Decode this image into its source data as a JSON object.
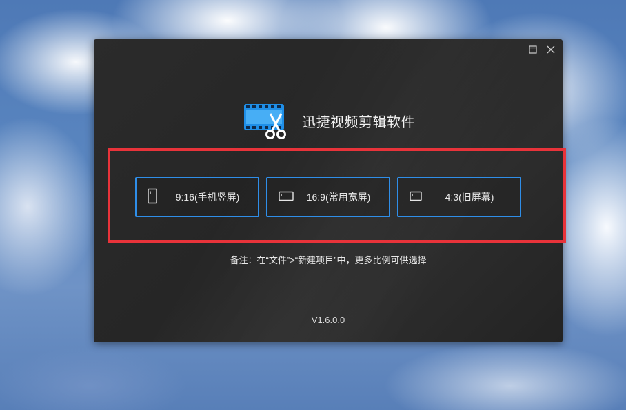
{
  "window": {
    "app_title": "迅捷视频剪辑软件",
    "controls": {
      "restore_icon": "restore-icon",
      "close_icon": "close-icon"
    }
  },
  "ratio_options": [
    {
      "label": "9:16(手机竖屏)",
      "icon": "portrait-screen-icon"
    },
    {
      "label": "16:9(常用宽屏)",
      "icon": "widescreen-icon"
    },
    {
      "label": "4:3(旧屏幕)",
      "icon": "standard-screen-icon"
    }
  ],
  "note": "备注：在“文件”>“新建项目”中，更多比例可供选择",
  "version": "V1.6.0.0",
  "colors": {
    "window_bg": "#262626",
    "button_border": "#2f8ee8",
    "highlight_border": "#e8333a",
    "logo_blue": "#1f8fe8"
  }
}
